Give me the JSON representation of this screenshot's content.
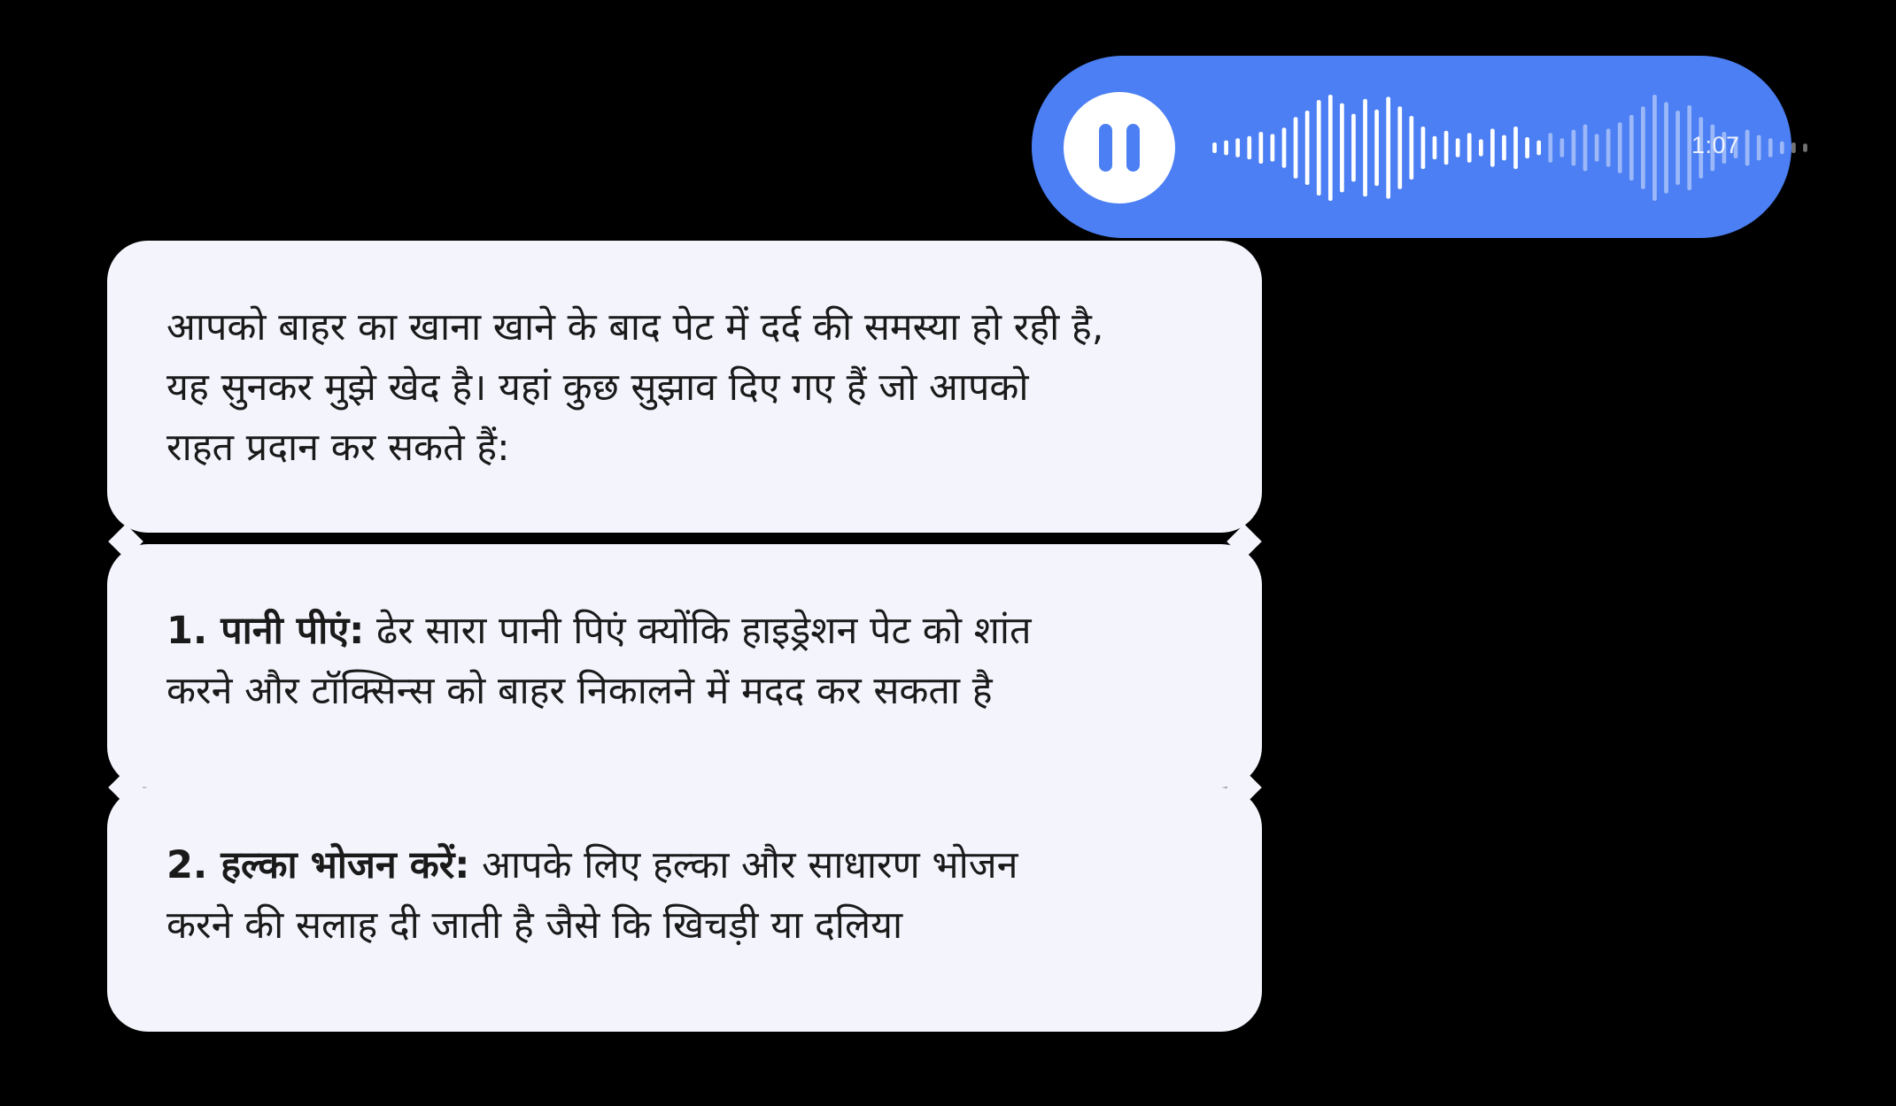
{
  "voice_message": {
    "duration": "1:07",
    "played_fraction": 0.55,
    "accent_color": "#4b7ff3",
    "icon": "pause-icon"
  },
  "reply": {
    "intro_lines": [
      "आपको बाहर का खाना खाने के बाद पेट में दर्द की समस्या हो रही है,",
      "यह सुनकर मुझे खेद है। यहां कुछ सुझाव दिए गए हैं जो आपको",
      "राहत प्रदान कर सकते हैं:"
    ],
    "tips": [
      {
        "title": "1. पानी पीएं:",
        "first_line": " ढेर सारा पानी पिएं क्योंकि हाइड्रेशन पेट को शांत",
        "second_line": "करने और टॉक्सिन्स को बाहर निकालने में मदद कर सकता है"
      },
      {
        "title": "2. हल्का भोजन करें:",
        "first_line": " आपके लिए हल्का और साधारण भोजन",
        "second_line": "करने की सलाह दी जाती है जैसे कि खिचड़ी या दलिया"
      }
    ]
  }
}
